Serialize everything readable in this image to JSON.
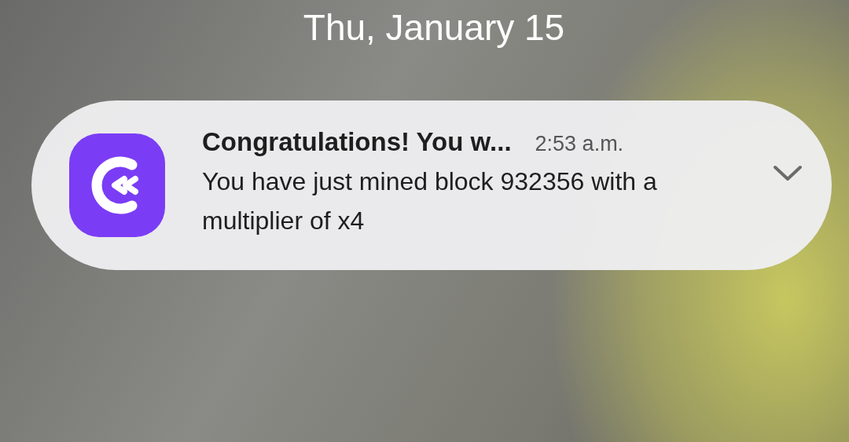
{
  "lock_screen": {
    "date": "Thu, January 15"
  },
  "notification": {
    "title": "Congratulations! You w...",
    "time": "2:53 a.m.",
    "body": "You have just mined block 932356 with a multiplier of x4",
    "expanded": false
  }
}
